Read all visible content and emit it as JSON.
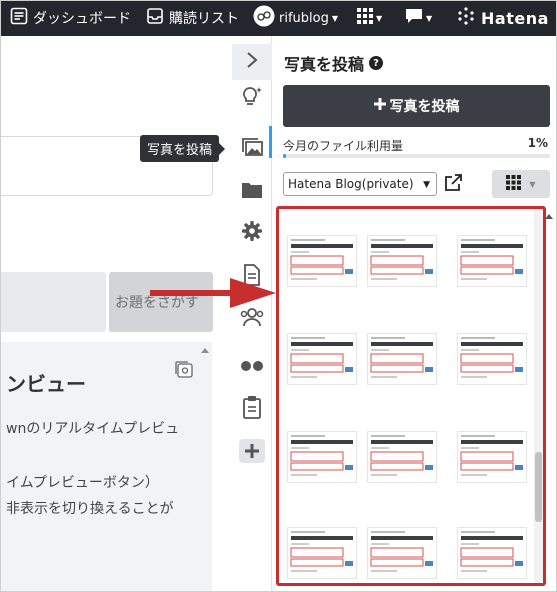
{
  "topbar": {
    "dashboard_label": "ダッシュボード",
    "subscriptions_label": "購読リスト",
    "user_name": "rifublog",
    "brand": "Hatena",
    "background": "#24262d"
  },
  "editor": {
    "topic_search_label": "お題をさがす",
    "preview_title": "ンビュー",
    "preview_lines": [
      "wnのリアルタイムプレビュ",
      "イムプレビューボタン）",
      "非表示を切り換えることが"
    ]
  },
  "rail": {
    "icons": [
      "chevron-right-icon",
      "lightbulb-icon",
      "photo-icon",
      "folder-icon",
      "gear-icon",
      "document-icon",
      "people-icon",
      "dots-icon",
      "clipboard-icon",
      "plus-icon"
    ]
  },
  "tooltip": {
    "text": "写真を投稿"
  },
  "photo_panel": {
    "title": "写真を投稿",
    "post_button_label": "写真を投稿",
    "usage_label": "今月のファイル利用量",
    "usage_value": "1%",
    "usage_fraction": 0.01,
    "blog_select": "Hatena Blog(private)",
    "accent_color": "#2a9df4",
    "highlight_color": "#c72e2e",
    "thumbnail_count": 12
  }
}
